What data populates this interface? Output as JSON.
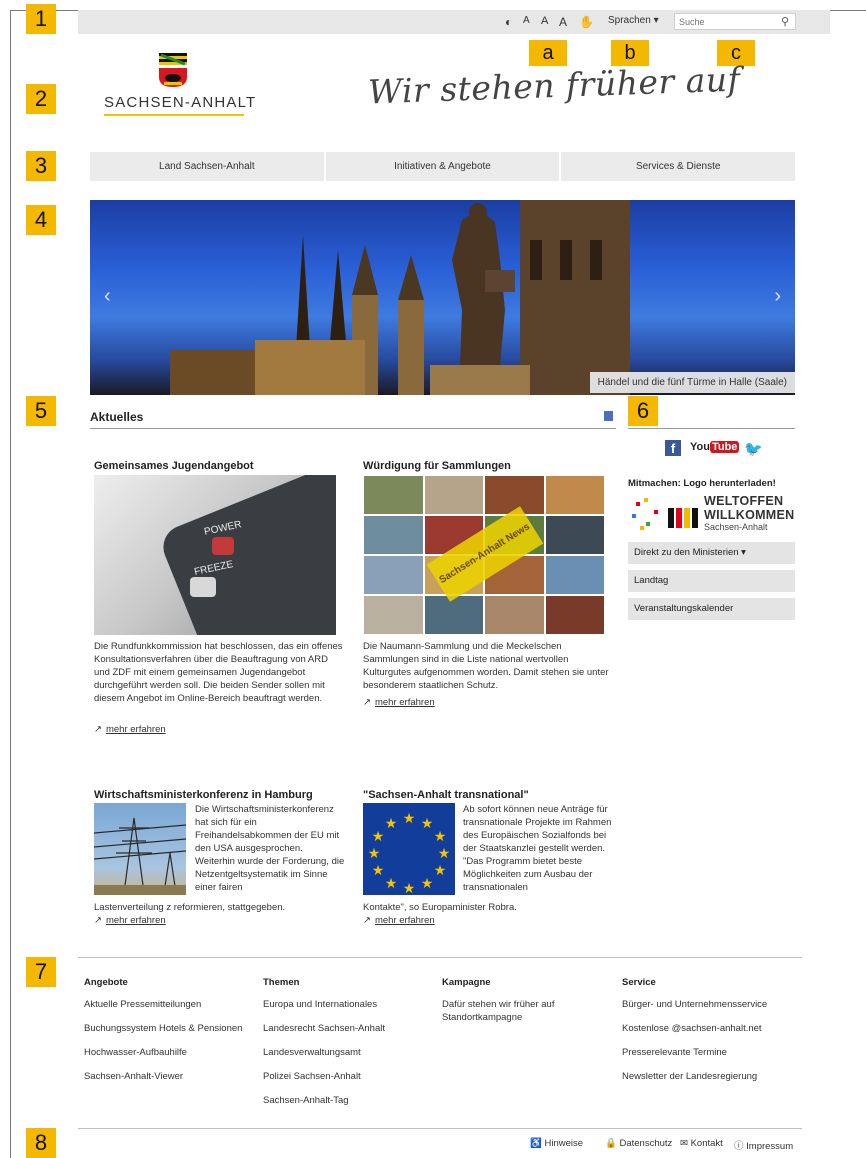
{
  "markers": {
    "n1": "1",
    "n2": "2",
    "n3": "3",
    "n4": "4",
    "n5": "5",
    "n6": "6",
    "n7": "7",
    "n8": "8",
    "a": "a",
    "b": "b",
    "c": "c"
  },
  "utility": {
    "contrast_icon": "◐",
    "font_decrease": "A",
    "font_normal": "A",
    "font_increase": "A",
    "sign_icon": "✋",
    "sprachen": "Sprachen ▾",
    "search_placeholder": "Suche",
    "search_icon": "⚲"
  },
  "header": {
    "brand": "SACHSEN-ANHALT",
    "slogan": "Wir stehen früher auf"
  },
  "nav": {
    "item1": "Land Sachsen-Anhalt",
    "item2": "Initiativen & Angebote",
    "item3": "Services & Dienste"
  },
  "hero": {
    "prev": "‹",
    "next": "›",
    "caption": "Händel und die fünf Türme in Halle (Saale)"
  },
  "aktuelles": {
    "title": "Aktuelles",
    "more_icon": "↗",
    "more_label": "mehr erfahren",
    "news1": {
      "title": "Gemeinsames Jugendangebot",
      "text": "Die Rundfunkkommission hat beschlossen, das ein offenes Konsultationsverfahren über die Beauftragung von ARD und ZDF mit einem gemeinsamen Jugendangebot durchgeführt werden soll. Die beiden Sender sollen mit diesem Angebot im Online-Bereich beauftragt werden.",
      "img_power": "POWER",
      "img_freeze": "FREEZE"
    },
    "news2": {
      "title": "Würdigung für Sammlungen",
      "text": "Die Naumann-Sammlung und die Meckelschen Sammlungen sind in die Liste national wertvollen Kulturgutes aufgenommen worden. Damit stehen sie unter besonderem staatlichen Schutz.",
      "badge": "Sachsen-Anhalt News"
    },
    "news3": {
      "title": "Wirtschaftsministerkonferenz in Hamburg",
      "text_side": "Die Wirtschaftsministerkonferenz hat sich für ein Freihandelsabkommen der EU mit den USA ausgesprochen. Weiterhin wurde der Forderung, die Netzentgeltsystematik im Sinne einer fairen",
      "text_full": "Lastenverteilung z reformieren, stattgegeben."
    },
    "news4": {
      "title": "\"Sachsen-Anhalt transnational\"",
      "text_side": "Ab sofort können neue Anträge für transnationale Projekte im Rahmen des Europäischen Sozialfonds bei der Staatskanzlei gestellt werden. \"Das Programm bietet beste Möglichkeiten zum Ausbau der transnationalen",
      "text_full": "Kontakte\", so Europaminister Robra."
    }
  },
  "sidebar": {
    "facebook": "f",
    "youtube_you": "You",
    "youtube_tube": "Tube",
    "twitter": "🐦",
    "mitmachen": "Mitmachen: Logo herunterladen!",
    "weltoffen": "WELTOFFEN",
    "willkommen": "WILLKOMMEN",
    "sachsen_anhalt": "Sachsen-Anhalt",
    "box1": "Direkt zu den Ministerien ▾",
    "box2": "Landtag",
    "box3": "Veranstaltungskalender"
  },
  "footer": {
    "col1": {
      "title": "Angebote",
      "links": [
        "Aktuelle Pressemitteilungen",
        "Buchungssystem Hotels & Pensionen",
        "Hochwasser-Aufbauhilfe",
        "Sachsen-Anhalt-Viewer"
      ]
    },
    "col2": {
      "title": "Themen",
      "links": [
        "Europa und Internationales",
        "Landesrecht Sachsen-Anhalt",
        "Landesverwaltungsamt",
        "Polizei Sachsen-Anhalt",
        "Sachsen-Anhalt-Tag"
      ]
    },
    "col3": {
      "title": "Kampagne",
      "links": [
        "Dafür stehen wir früher auf Standortkampagne"
      ]
    },
    "col4": {
      "title": "Service",
      "links": [
        "Bürger- und Unternehmensservice",
        "Kostenlose @sachsen-anhalt.net",
        "Presserelevante Termine",
        "Newsletter der Landesregierung"
      ]
    }
  },
  "bottom": {
    "hinweise": "♿ Hinweise",
    "datenschutz": "🔒 Datenschutz",
    "kontakt": "✉ Kontakt",
    "impressum": "ⓘ Impressum"
  },
  "colors": {
    "marker": "#f5b800",
    "topbar": "#e7e7e7",
    "nav": "#ebebeb",
    "eu_blue": "#123d9a",
    "twitter": "#1da1f2",
    "facebook": "#3b5998",
    "youtube": "#cc181e"
  }
}
